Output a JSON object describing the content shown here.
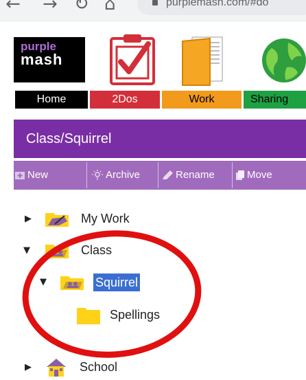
{
  "browser": {
    "url": "purplemash.com/#do",
    "back_glyph": "←",
    "forward_glyph": "→",
    "reload_glyph": "↻",
    "home_glyph": "⌂"
  },
  "app": {
    "logo_line1": "purple",
    "logo_line2": "mash",
    "tabs": [
      {
        "label": "Home"
      },
      {
        "label": "2Dos"
      },
      {
        "label": "Work"
      },
      {
        "label": "Sharing"
      }
    ]
  },
  "path": {
    "title": "Class/Squirrel"
  },
  "toolbar": {
    "new": "New",
    "archive": "Archive",
    "rename": "Rename",
    "move": "Move"
  },
  "tree": {
    "items": [
      {
        "label": "My Work",
        "expanded": false
      },
      {
        "label": "Class",
        "expanded": true
      },
      {
        "label": "Squirrel",
        "expanded": true,
        "selected": true
      },
      {
        "label": "Spellings"
      },
      {
        "label": "School",
        "expanded": false
      }
    ]
  },
  "colors": {
    "brand_purple": "#7a2ea5",
    "toolbar_purple": "#a06bbd",
    "selection_blue": "#3a6fd1",
    "annotation_red": "#e01010",
    "folder_yellow": "#ffd21a"
  },
  "icons": {
    "tree_collapsed": "caret-right-icon",
    "tree_expanded": "caret-down-icon",
    "my_work": "folder-pencil-icon",
    "class": "folder-people-icon",
    "squirrel": "folder-people-icon",
    "spellings": "folder-icon",
    "school": "school-house-icon"
  }
}
